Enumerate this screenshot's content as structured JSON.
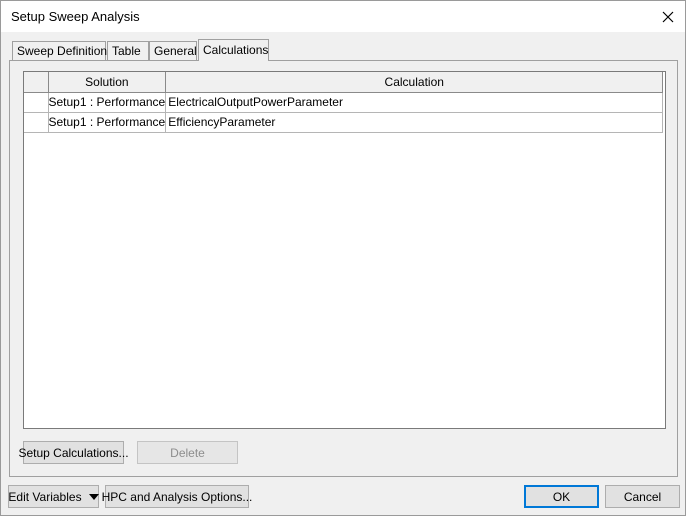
{
  "window": {
    "title": "Setup Sweep Analysis"
  },
  "tabs": [
    {
      "label": "Sweep Definitions"
    },
    {
      "label": "Table"
    },
    {
      "label": "General"
    },
    {
      "label": "Calculations"
    }
  ],
  "grid": {
    "columns": [
      "Solution",
      "Calculation"
    ],
    "rows": [
      {
        "solution": "Setup1 : Performance",
        "calculation": "ElectricalOutputPowerParameter"
      },
      {
        "solution": "Setup1 : Performance",
        "calculation": "EfficiencyParameter"
      }
    ]
  },
  "buttons": {
    "setup_calculations": "Setup Calculations...",
    "delete": "Delete",
    "edit_variables": "Edit Variables",
    "hpc_options": "HPC and Analysis Options...",
    "ok": "OK",
    "cancel": "Cancel"
  }
}
